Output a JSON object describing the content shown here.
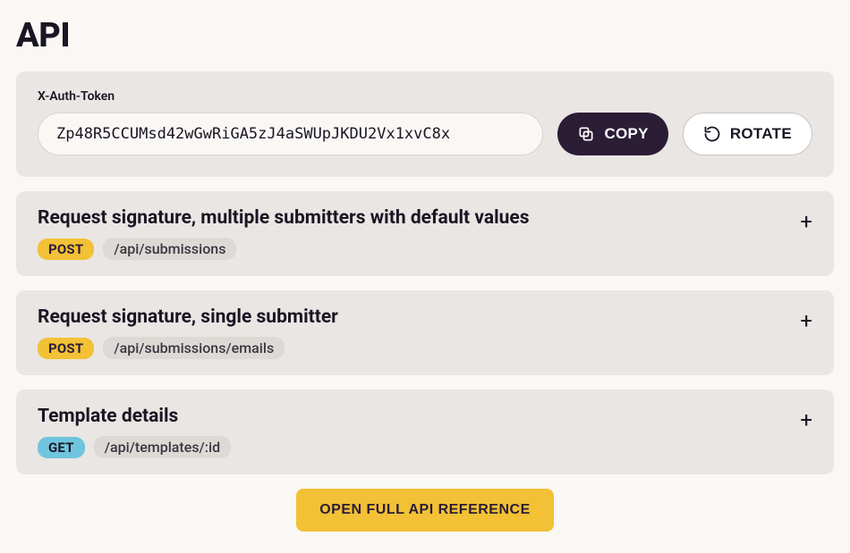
{
  "header": {
    "title": "API"
  },
  "token": {
    "label": "X-Auth-Token",
    "value": "Zp48R5CCUMsd42wGwRiGA5zJ4aSWUpJKDU2Vx1xvC8x",
    "copy_label": "COPY",
    "rotate_label": "ROTATE"
  },
  "endpoints": [
    {
      "title": "Request signature, multiple submitters with default values",
      "method": "POST",
      "path": "/api/submissions"
    },
    {
      "title": "Request signature, single submitter",
      "method": "POST",
      "path": "/api/submissions/emails"
    },
    {
      "title": "Template details",
      "method": "GET",
      "path": "/api/templates/:id"
    }
  ],
  "footer": {
    "open_reference_label": "OPEN FULL API REFERENCE"
  },
  "icons": {
    "plus": "+",
    "copy": "copy-icon",
    "rotate": "rotate-icon"
  }
}
